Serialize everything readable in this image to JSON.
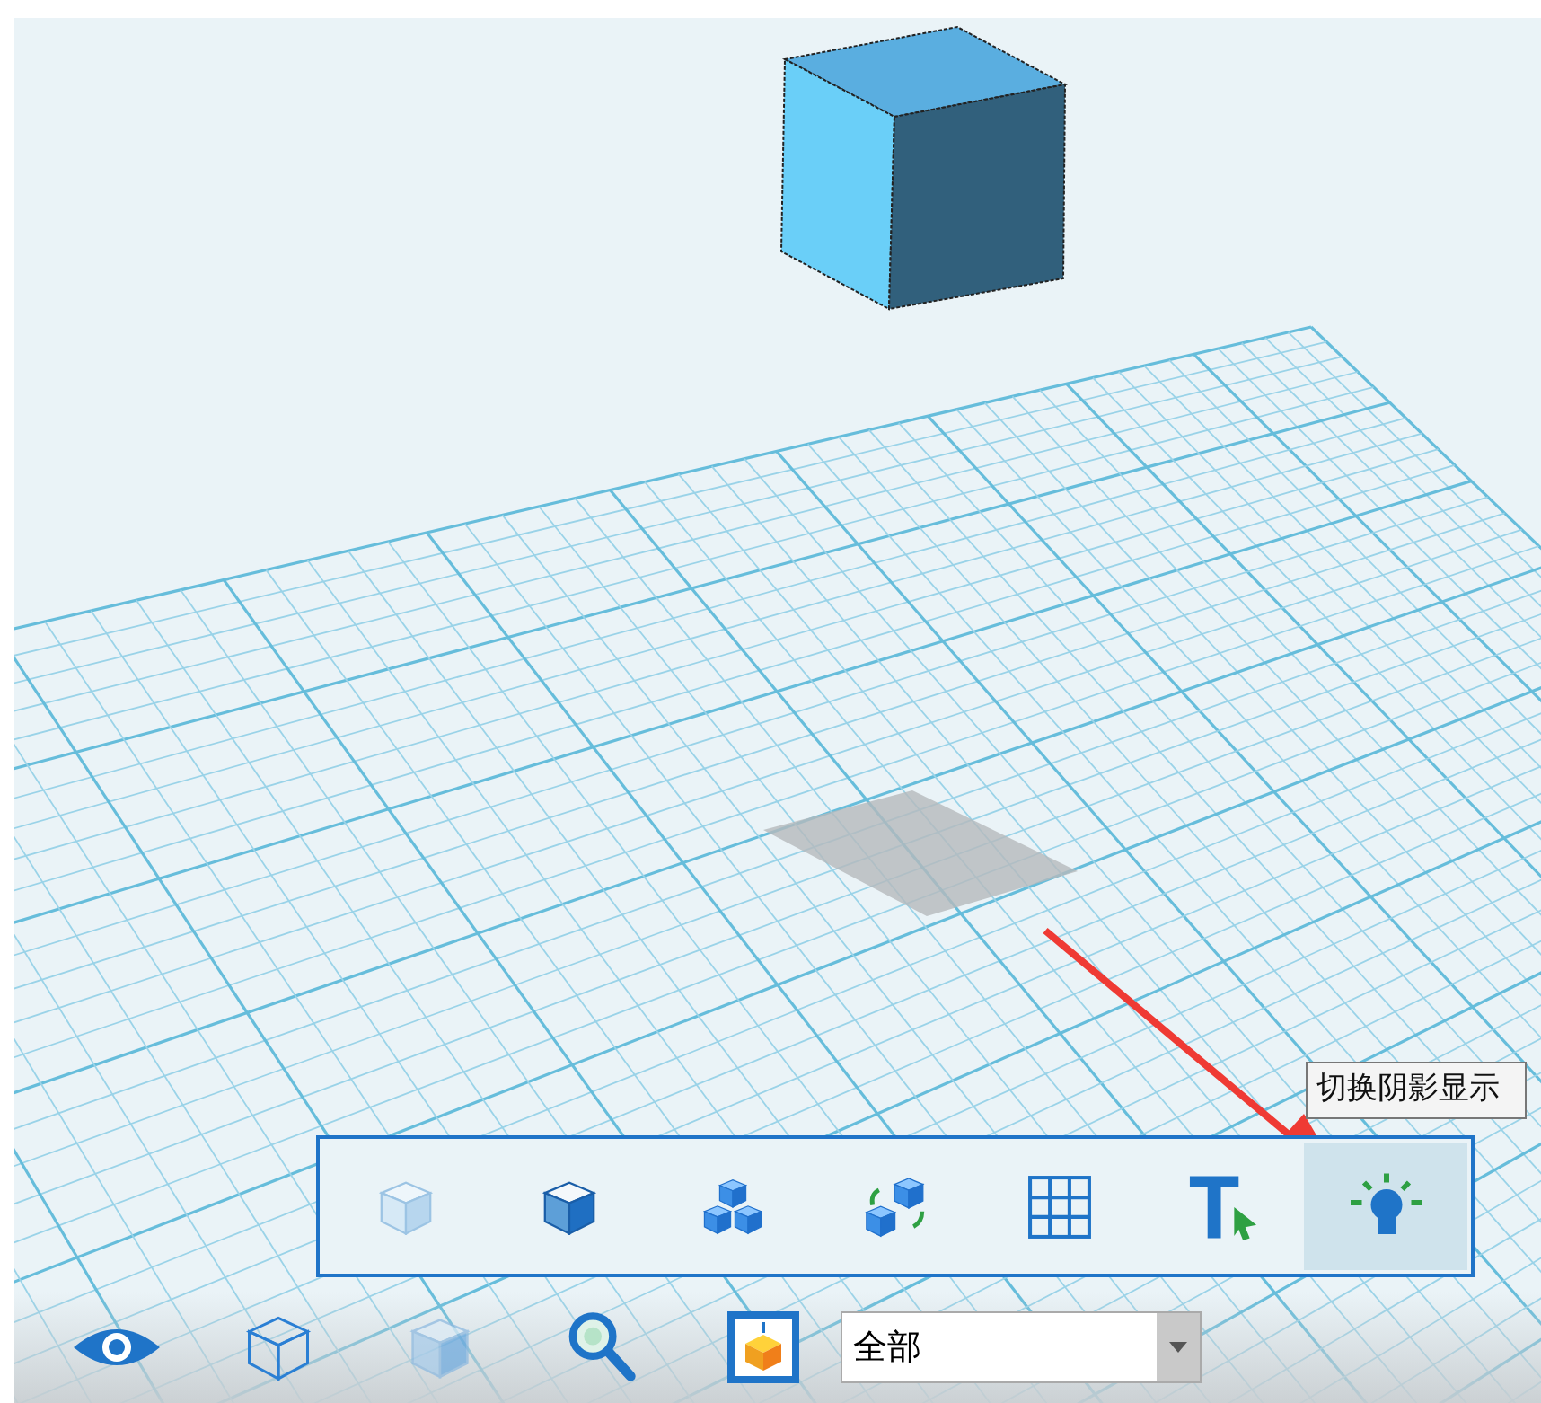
{
  "tooltip": {
    "text": "切换阴影显示"
  },
  "view_toolbar": {
    "buttons": [
      {
        "kind": "ghost-cube",
        "selected": false
      },
      {
        "kind": "solid-cube",
        "selected": false
      },
      {
        "kind": "cube-stack",
        "selected": false
      },
      {
        "kind": "cube-swap",
        "selected": false
      },
      {
        "kind": "grid",
        "selected": false
      },
      {
        "kind": "text-pointer",
        "selected": false
      },
      {
        "kind": "bulb",
        "selected": true
      }
    ]
  },
  "bottom_bar": {
    "tools": [
      {
        "kind": "eye"
      },
      {
        "kind": "wire-cube"
      },
      {
        "kind": "faded-cube"
      },
      {
        "kind": "zoom"
      },
      {
        "kind": "frame-cube"
      }
    ],
    "filter_select": {
      "value": "全部"
    }
  }
}
